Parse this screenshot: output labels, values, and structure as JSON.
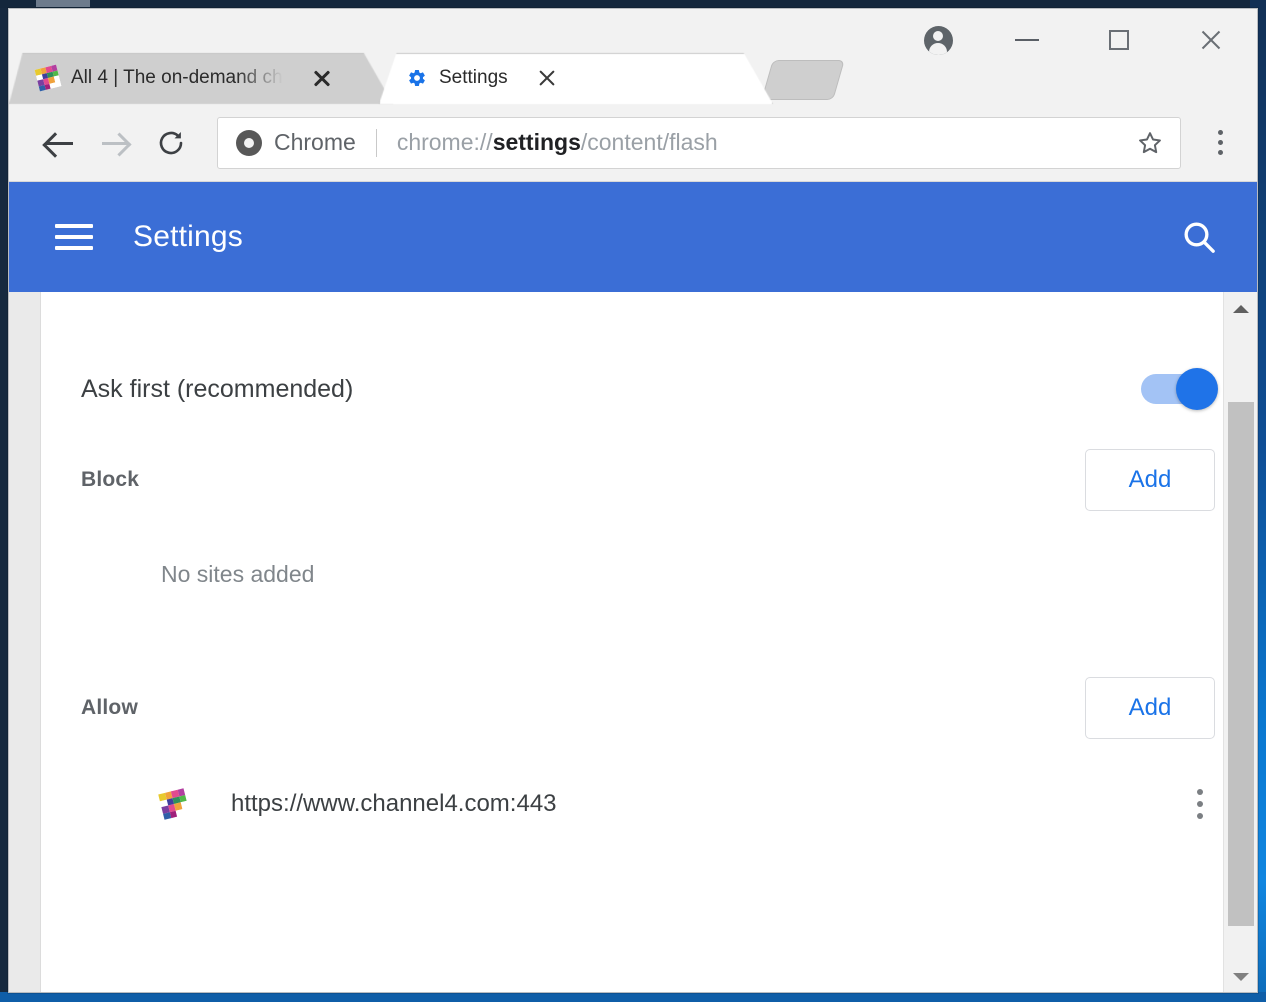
{
  "window": {
    "controls": {
      "account_label": "Account",
      "minimize_label": "Minimize",
      "maximize_label": "Maximize",
      "close_label": "Close"
    }
  },
  "tabs": [
    {
      "title": "All 4 | The on-demand ch",
      "favicon": "channel4-favicon",
      "active": false,
      "close_label": "Close tab"
    },
    {
      "title": "Settings",
      "favicon": "gear-icon",
      "active": true,
      "close_label": "Close tab"
    }
  ],
  "newtab": {
    "label": "New tab"
  },
  "toolbar": {
    "back_label": "Back",
    "forward_label": "Forward",
    "reload_label": "Reload",
    "security_chip": "Chrome",
    "url_prefix": "chrome://",
    "url_bold": "settings",
    "url_suffix": "/content/flash",
    "url_full": "chrome://settings/content/flash",
    "bookmark_label": "Bookmark this page",
    "menu_label": "Customize and control Google Chrome"
  },
  "settings_header": {
    "menu_label": "Main menu",
    "title": "Settings",
    "search_label": "Search settings"
  },
  "page": {
    "ask_first": {
      "label": "Ask first (recommended)",
      "toggle_state": "on"
    },
    "block": {
      "title": "Block",
      "add_label": "Add",
      "empty_text": "No sites added",
      "sites": []
    },
    "allow": {
      "title": "Allow",
      "add_label": "Add",
      "sites": [
        {
          "url": "https://www.channel4.com:443",
          "favicon": "channel4-favicon",
          "menu_label": "More actions"
        }
      ]
    }
  },
  "scrollbar": {
    "up_label": "Scroll up",
    "down_label": "Scroll down",
    "thumb_label": "Scroll thumb"
  },
  "colors": {
    "header_blue": "#3b6ed6",
    "accent_blue": "#1a73e8",
    "toggle_track": "#a3c3f5",
    "toggle_knob": "#1f73e8",
    "text_primary": "#3c4043",
    "text_secondary": "#5f6368",
    "text_muted": "#80868b"
  }
}
